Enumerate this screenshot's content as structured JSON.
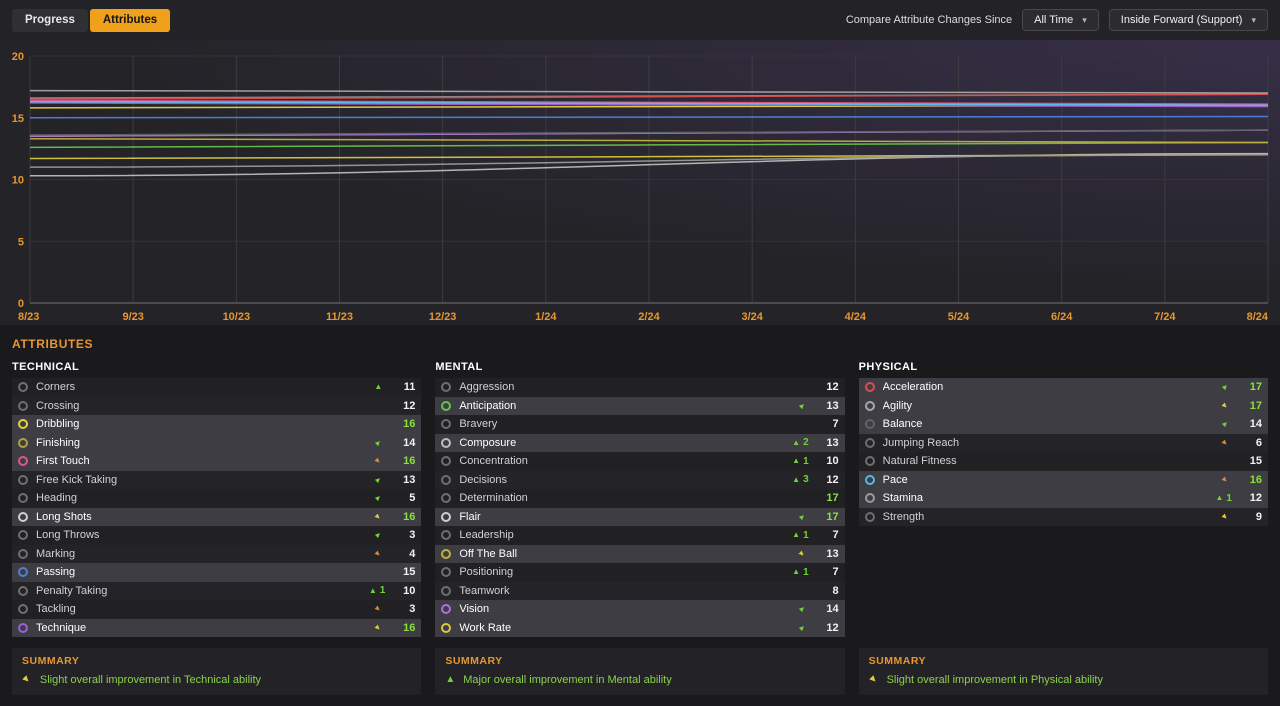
{
  "colors": {
    "accent": "#e8962e",
    "green": "#6fd435",
    "yellow": "#e0cf3a",
    "orange": "#dd8a3a",
    "value_high": "#8ae03c",
    "value_normal": "#f2f2f2"
  },
  "topbar": {
    "tabs": [
      {
        "label": "Progress"
      },
      {
        "label": "Attributes"
      }
    ],
    "compare_label": "Compare Attribute Changes Since",
    "timeframe_dropdown": "All Time",
    "role_dropdown": "Inside Forward (Support)"
  },
  "chart_data": {
    "type": "line",
    "x_ticks": [
      "8/23",
      "9/23",
      "10/23",
      "11/23",
      "12/23",
      "1/24",
      "2/24",
      "3/24",
      "4/24",
      "5/24",
      "6/24",
      "7/24",
      "8/24"
    ],
    "y_ticks": [
      0,
      5,
      10,
      15,
      20
    ],
    "ylim": [
      0,
      20
    ],
    "grid": true,
    "series": [
      {
        "name": "Dribbling",
        "color": "#e6d23c",
        "start": 15.8,
        "end": 16.0
      },
      {
        "name": "Finishing",
        "color": "#b0a23c",
        "start": 13.5,
        "end": 14.0
      },
      {
        "name": "First Touch",
        "color": "#e0568e",
        "start": 16.4,
        "end": 16.1
      },
      {
        "name": "Long Shots",
        "color": "#cfcfcf",
        "start": 16.3,
        "end": 16.0
      },
      {
        "name": "Passing",
        "color": "#4f7fd9",
        "start": 15.0,
        "end": 15.1
      },
      {
        "name": "Technique",
        "color": "#9a5fd9",
        "start": 16.2,
        "end": 15.9
      },
      {
        "name": "Anticipation",
        "color": "#69c24a",
        "start": 12.6,
        "end": 13.0
      },
      {
        "name": "Composure",
        "color": "#bdbdbd",
        "start": 10.3,
        "end": 12.1
      },
      {
        "name": "Flair",
        "color": "#8f8f8f",
        "start": 16.6,
        "end": 16.9
      },
      {
        "name": "Off The Ball",
        "color": "#c2b13c",
        "start": 13.3,
        "end": 13.0
      },
      {
        "name": "Vision",
        "color": "#b06fe0",
        "start": 13.5,
        "end": 14.0
      },
      {
        "name": "Work Rate",
        "color": "#d9c93c",
        "start": 11.7,
        "end": 12.0
      },
      {
        "name": "Acceleration",
        "color": "#d94f4f",
        "start": 16.5,
        "end": 16.9
      },
      {
        "name": "Agility",
        "color": "#a8a8a8",
        "start": 17.2,
        "end": 17.0
      },
      {
        "name": "Balance",
        "color": "#62626a",
        "start": 13.6,
        "end": 14.0
      },
      {
        "name": "Pace",
        "color": "#57b8e8",
        "start": 16.3,
        "end": 16.0
      },
      {
        "name": "Stamina",
        "color": "#9a9a9a",
        "start": 11.0,
        "end": 12.0
      }
    ]
  },
  "attributes": {
    "section_title": "ATTRIBUTES",
    "groups": [
      {
        "title": "TECHNICAL",
        "rows": [
          {
            "name": "Corners",
            "value": 11,
            "arrow": "up",
            "arrow_color": "green",
            "delta": "",
            "highlight": false,
            "icon": "#6f6f6f"
          },
          {
            "name": "Crossing",
            "value": 12,
            "arrow": "",
            "arrow_color": "",
            "delta": "",
            "highlight": false,
            "icon": "#6f6f6f"
          },
          {
            "name": "Dribbling",
            "value": 16,
            "arrow": "",
            "arrow_color": "",
            "delta": "",
            "highlight": true,
            "icon": "#e6d23c"
          },
          {
            "name": "Finishing",
            "value": 14,
            "arrow": "diag-up",
            "arrow_color": "green",
            "delta": "",
            "highlight": true,
            "icon": "#b0a23c"
          },
          {
            "name": "First Touch",
            "value": 16,
            "arrow": "diag-down",
            "arrow_color": "orange",
            "delta": "",
            "highlight": true,
            "icon": "#e0568e"
          },
          {
            "name": "Free Kick Taking",
            "value": 13,
            "arrow": "diag-up",
            "arrow_color": "green",
            "delta": "",
            "highlight": false,
            "icon": "#6f6f6f"
          },
          {
            "name": "Heading",
            "value": 5,
            "arrow": "diag-up",
            "arrow_color": "green",
            "delta": "",
            "highlight": false,
            "icon": "#6f6f6f"
          },
          {
            "name": "Long Shots",
            "value": 16,
            "arrow": "diag-down",
            "arrow_color": "yellow",
            "delta": "",
            "highlight": true,
            "icon": "#cfcfcf"
          },
          {
            "name": "Long Throws",
            "value": 3,
            "arrow": "diag-up",
            "arrow_color": "green",
            "delta": "",
            "highlight": false,
            "icon": "#6f6f6f"
          },
          {
            "name": "Marking",
            "value": 4,
            "arrow": "diag-down",
            "arrow_color": "orange",
            "delta": "",
            "highlight": false,
            "icon": "#6f6f6f"
          },
          {
            "name": "Passing",
            "value": 15,
            "arrow": "",
            "arrow_color": "",
            "delta": "",
            "highlight": true,
            "icon": "#4f7fd9"
          },
          {
            "name": "Penalty Taking",
            "value": 10,
            "arrow": "up",
            "arrow_color": "green",
            "delta": "1",
            "highlight": false,
            "icon": "#6f6f6f"
          },
          {
            "name": "Tackling",
            "value": 3,
            "arrow": "diag-down",
            "arrow_color": "orange",
            "delta": "",
            "highlight": false,
            "icon": "#6f6f6f"
          },
          {
            "name": "Technique",
            "value": 16,
            "arrow": "diag-down",
            "arrow_color": "yellow",
            "delta": "",
            "highlight": true,
            "icon": "#9a5fd9"
          }
        ],
        "summary": {
          "title": "SUMMARY",
          "arrow": "diag-down",
          "arrow_color": "yellow",
          "text": "Slight overall improvement in Technical ability"
        }
      },
      {
        "title": "MENTAL",
        "rows": [
          {
            "name": "Aggression",
            "value": 12,
            "arrow": "",
            "arrow_color": "",
            "delta": "",
            "highlight": false,
            "icon": "#6f6f6f"
          },
          {
            "name": "Anticipation",
            "value": 13,
            "arrow": "diag-up",
            "arrow_color": "green",
            "delta": "",
            "highlight": true,
            "icon": "#69c24a"
          },
          {
            "name": "Bravery",
            "value": 7,
            "arrow": "",
            "arrow_color": "",
            "delta": "",
            "highlight": false,
            "icon": "#6f6f6f"
          },
          {
            "name": "Composure",
            "value": 13,
            "arrow": "up",
            "arrow_color": "green",
            "delta": "2",
            "highlight": true,
            "icon": "#bdbdbd"
          },
          {
            "name": "Concentration",
            "value": 10,
            "arrow": "up",
            "arrow_color": "green",
            "delta": "1",
            "highlight": false,
            "icon": "#6f6f6f"
          },
          {
            "name": "Decisions",
            "value": 12,
            "arrow": "up",
            "arrow_color": "green",
            "delta": "3",
            "highlight": false,
            "icon": "#6f6f6f"
          },
          {
            "name": "Determination",
            "value": 17,
            "arrow": "",
            "arrow_color": "",
            "delta": "",
            "highlight": false,
            "icon": "#6f6f6f"
          },
          {
            "name": "Flair",
            "value": 17,
            "arrow": "diag-up",
            "arrow_color": "green",
            "delta": "",
            "highlight": true,
            "icon": "#cfcfcf"
          },
          {
            "name": "Leadership",
            "value": 7,
            "arrow": "up",
            "arrow_color": "green",
            "delta": "1",
            "highlight": false,
            "icon": "#6f6f6f"
          },
          {
            "name": "Off The Ball",
            "value": 13,
            "arrow": "diag-down",
            "arrow_color": "yellow",
            "delta": "",
            "highlight": true,
            "icon": "#c2b13c"
          },
          {
            "name": "Positioning",
            "value": 7,
            "arrow": "up",
            "arrow_color": "green",
            "delta": "1",
            "highlight": false,
            "icon": "#6f6f6f"
          },
          {
            "name": "Teamwork",
            "value": 8,
            "arrow": "",
            "arrow_color": "",
            "delta": "",
            "highlight": false,
            "icon": "#6f6f6f"
          },
          {
            "name": "Vision",
            "value": 14,
            "arrow": "diag-up",
            "arrow_color": "green",
            "delta": "",
            "highlight": true,
            "icon": "#b06fe0"
          },
          {
            "name": "Work Rate",
            "value": 12,
            "arrow": "diag-up",
            "arrow_color": "green",
            "delta": "",
            "highlight": true,
            "icon": "#d9c93c"
          }
        ],
        "summary": {
          "title": "SUMMARY",
          "arrow": "up",
          "arrow_color": "green",
          "text": "Major overall improvement in Mental ability"
        }
      },
      {
        "title": "PHYSICAL",
        "rows": [
          {
            "name": "Acceleration",
            "value": 17,
            "arrow": "diag-up",
            "arrow_color": "green",
            "delta": "",
            "highlight": true,
            "icon": "#d94f4f"
          },
          {
            "name": "Agility",
            "value": 17,
            "arrow": "diag-down",
            "arrow_color": "yellow",
            "delta": "",
            "highlight": true,
            "icon": "#a8a8a8"
          },
          {
            "name": "Balance",
            "value": 14,
            "arrow": "diag-up",
            "arrow_color": "green",
            "delta": "",
            "highlight": true,
            "icon": "#62626a"
          },
          {
            "name": "Jumping Reach",
            "value": 6,
            "arrow": "diag-down",
            "arrow_color": "orange",
            "delta": "",
            "highlight": false,
            "icon": "#6f6f6f"
          },
          {
            "name": "Natural Fitness",
            "value": 15,
            "arrow": "",
            "arrow_color": "",
            "delta": "",
            "highlight": false,
            "icon": "#6f6f6f"
          },
          {
            "name": "Pace",
            "value": 16,
            "arrow": "diag-down",
            "arrow_color": "orange",
            "delta": "",
            "highlight": true,
            "icon": "#57b8e8"
          },
          {
            "name": "Stamina",
            "value": 12,
            "arrow": "up",
            "arrow_color": "green",
            "delta": "1",
            "highlight": true,
            "icon": "#9a9a9a"
          },
          {
            "name": "Strength",
            "value": 9,
            "arrow": "diag-down",
            "arrow_color": "yellow",
            "delta": "",
            "highlight": false,
            "icon": "#6f6f6f"
          }
        ],
        "summary": {
          "title": "SUMMARY",
          "arrow": "diag-down",
          "arrow_color": "yellow",
          "text": "Slight overall improvement in Physical ability"
        }
      }
    ]
  }
}
